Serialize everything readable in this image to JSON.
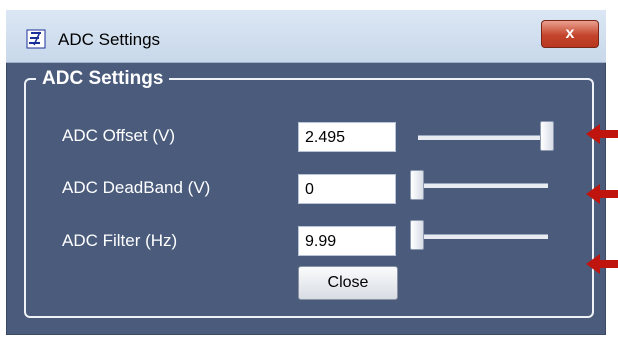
{
  "window": {
    "title": "ADC Settings",
    "close_glyph": "x"
  },
  "group": {
    "title": "ADC Settings"
  },
  "rows": [
    {
      "label": "ADC Offset (V)",
      "value": "2.495",
      "slider_fraction": 1.0
    },
    {
      "label": "ADC DeadBand (V)",
      "value": "0",
      "slider_fraction": 0.0
    },
    {
      "label": "ADC Filter (Hz)",
      "value": "9.99",
      "slider_fraction": 0.0
    }
  ],
  "buttons": {
    "close_label": "Close"
  },
  "annotations": {
    "arrow_color": "#c0150e",
    "arrow_count": 3
  },
  "colors": {
    "client_bg": "#4a5b7c",
    "accent": "#c0150e"
  },
  "icons": {
    "app_icon": "app-logo-icon",
    "close_icon": "close-icon"
  }
}
